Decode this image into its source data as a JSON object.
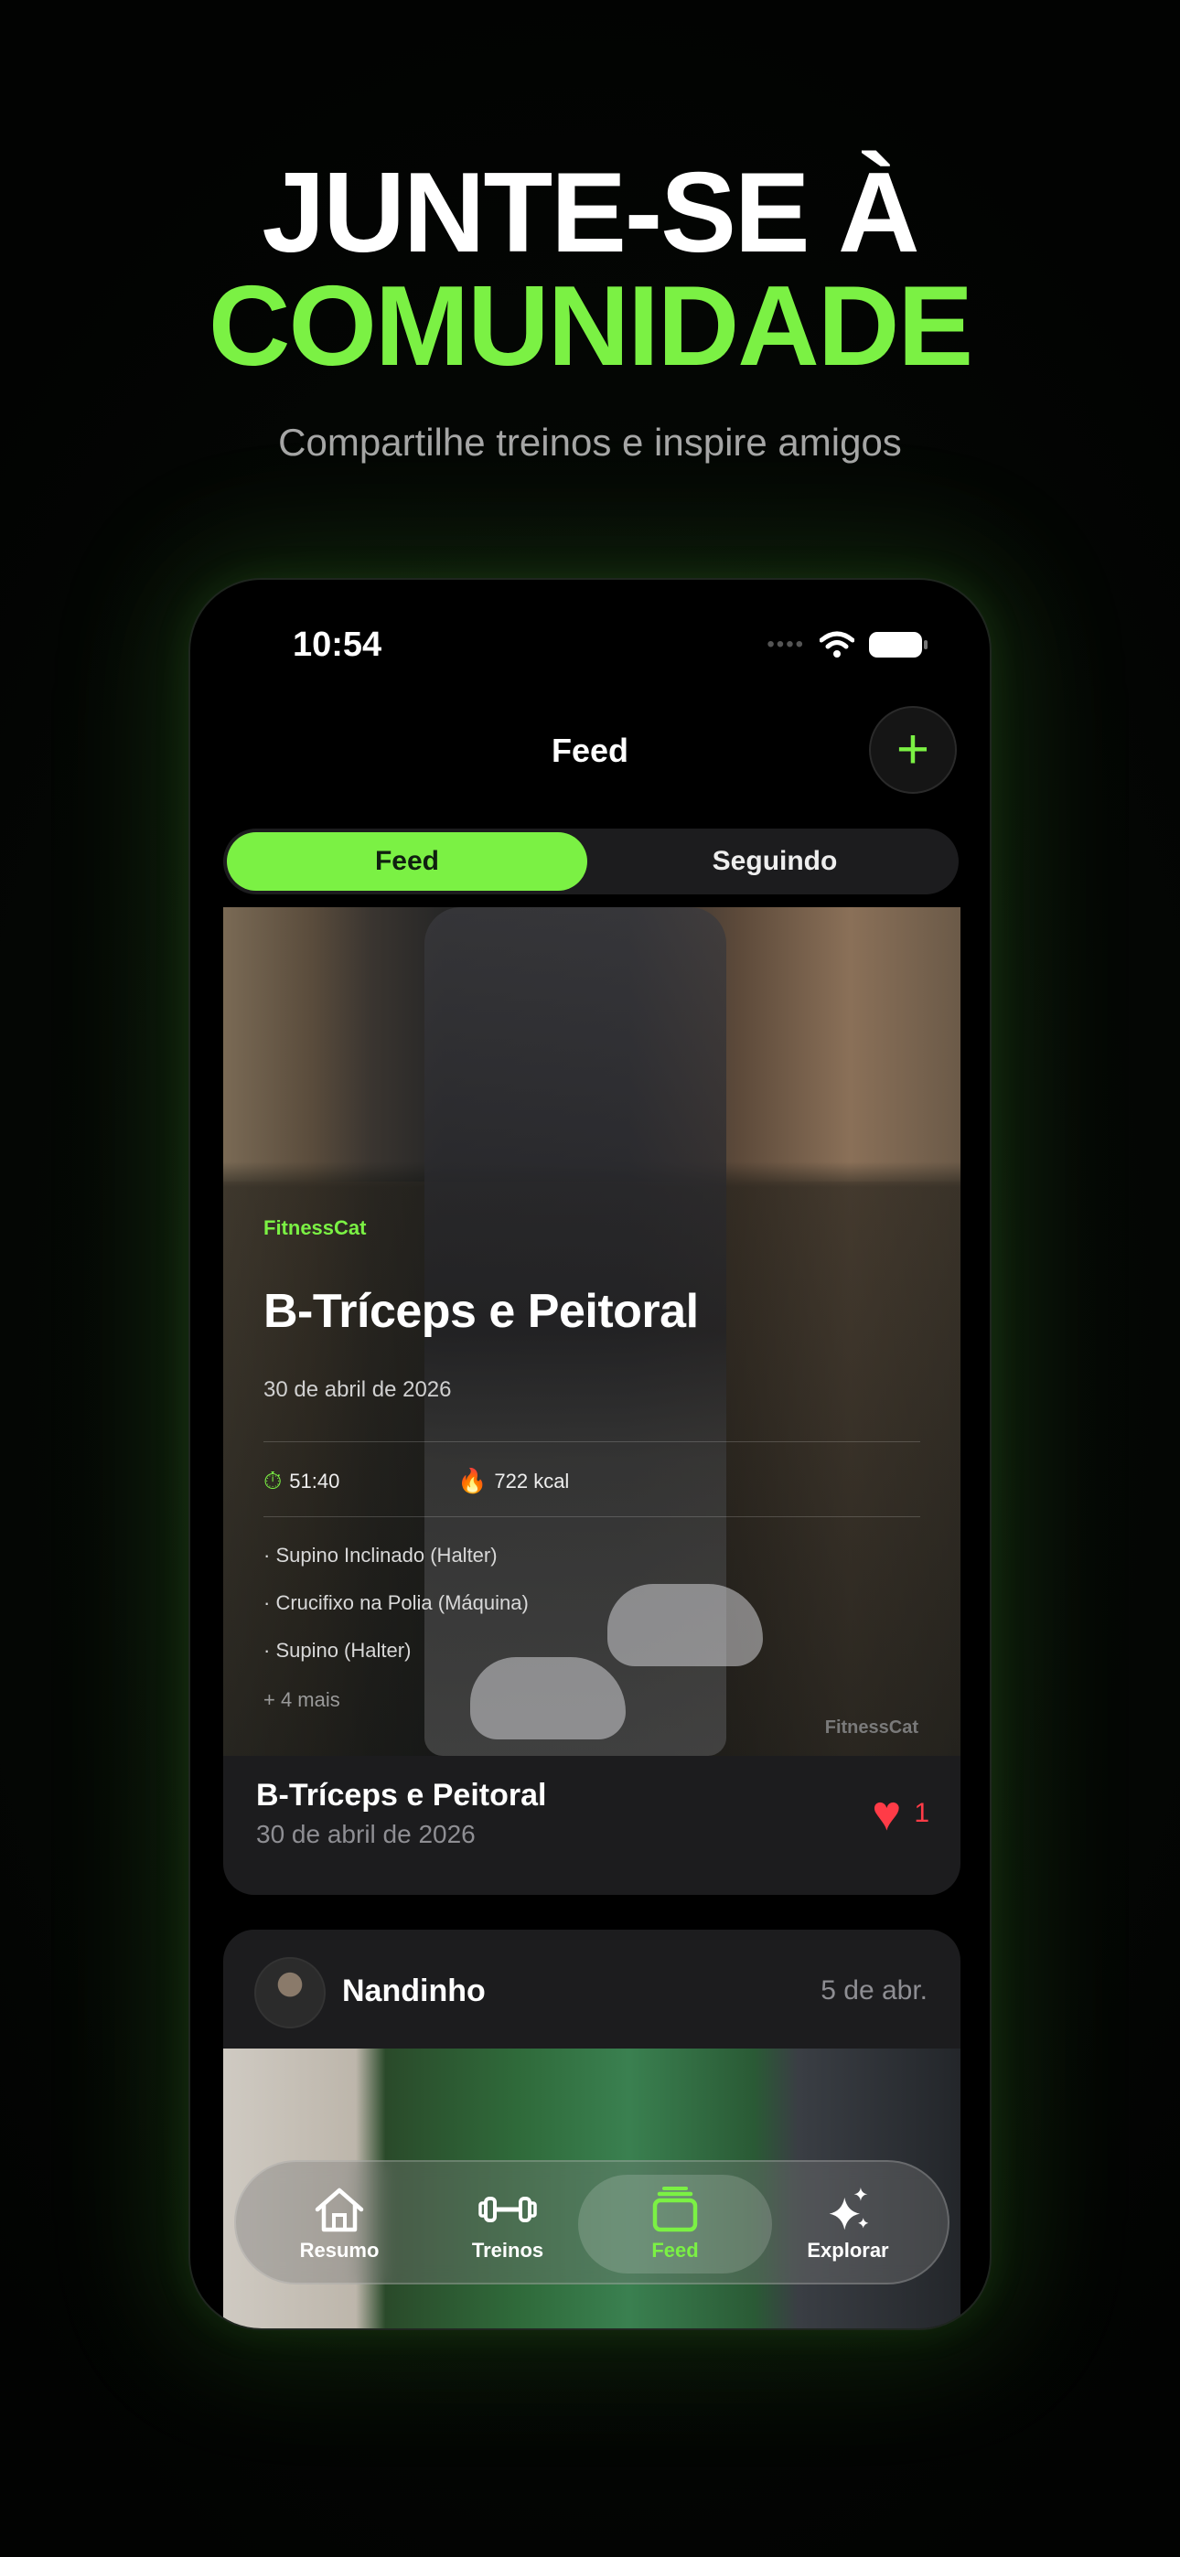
{
  "hero": {
    "line1": "JUNTE-SE À",
    "line2": "COMUNIDADE",
    "subtitle": "Compartilhe treinos e inspire amigos"
  },
  "status_bar": {
    "time": "10:54"
  },
  "nav": {
    "title": "Feed",
    "add_icon": "plus-icon"
  },
  "segments": {
    "active": "Feed",
    "inactive": "Seguindo"
  },
  "post1": {
    "overlay_user": "FitnessCat",
    "overlay_title": "B-Tríceps e Peitoral",
    "overlay_date": "30 de abril de 2026",
    "duration": "51:40",
    "calories": "722 kcal",
    "exercises": [
      "· Supino Inclinado (Halter)",
      "· Crucifixo na Polia (Máquina)",
      "· Supino (Halter)"
    ],
    "more": "+ 4 mais",
    "watermark": "FitnessCat",
    "title": "B-Tríceps e Peitoral",
    "date": "30 de abril de 2026",
    "likes": "1"
  },
  "post2": {
    "user": "Nandinho",
    "date": "5 de abr."
  },
  "tabbar": {
    "items": [
      {
        "label": "Resumo",
        "icon": "home-icon"
      },
      {
        "label": "Treinos",
        "icon": "dumbbell-icon"
      },
      {
        "label": "Feed",
        "icon": "feed-icon"
      },
      {
        "label": "Explorar",
        "icon": "sparkles-icon"
      }
    ],
    "active": "Feed"
  },
  "colors": {
    "accent": "#7bf144",
    "like": "#ff3b47",
    "card": "#1c1c1e"
  }
}
